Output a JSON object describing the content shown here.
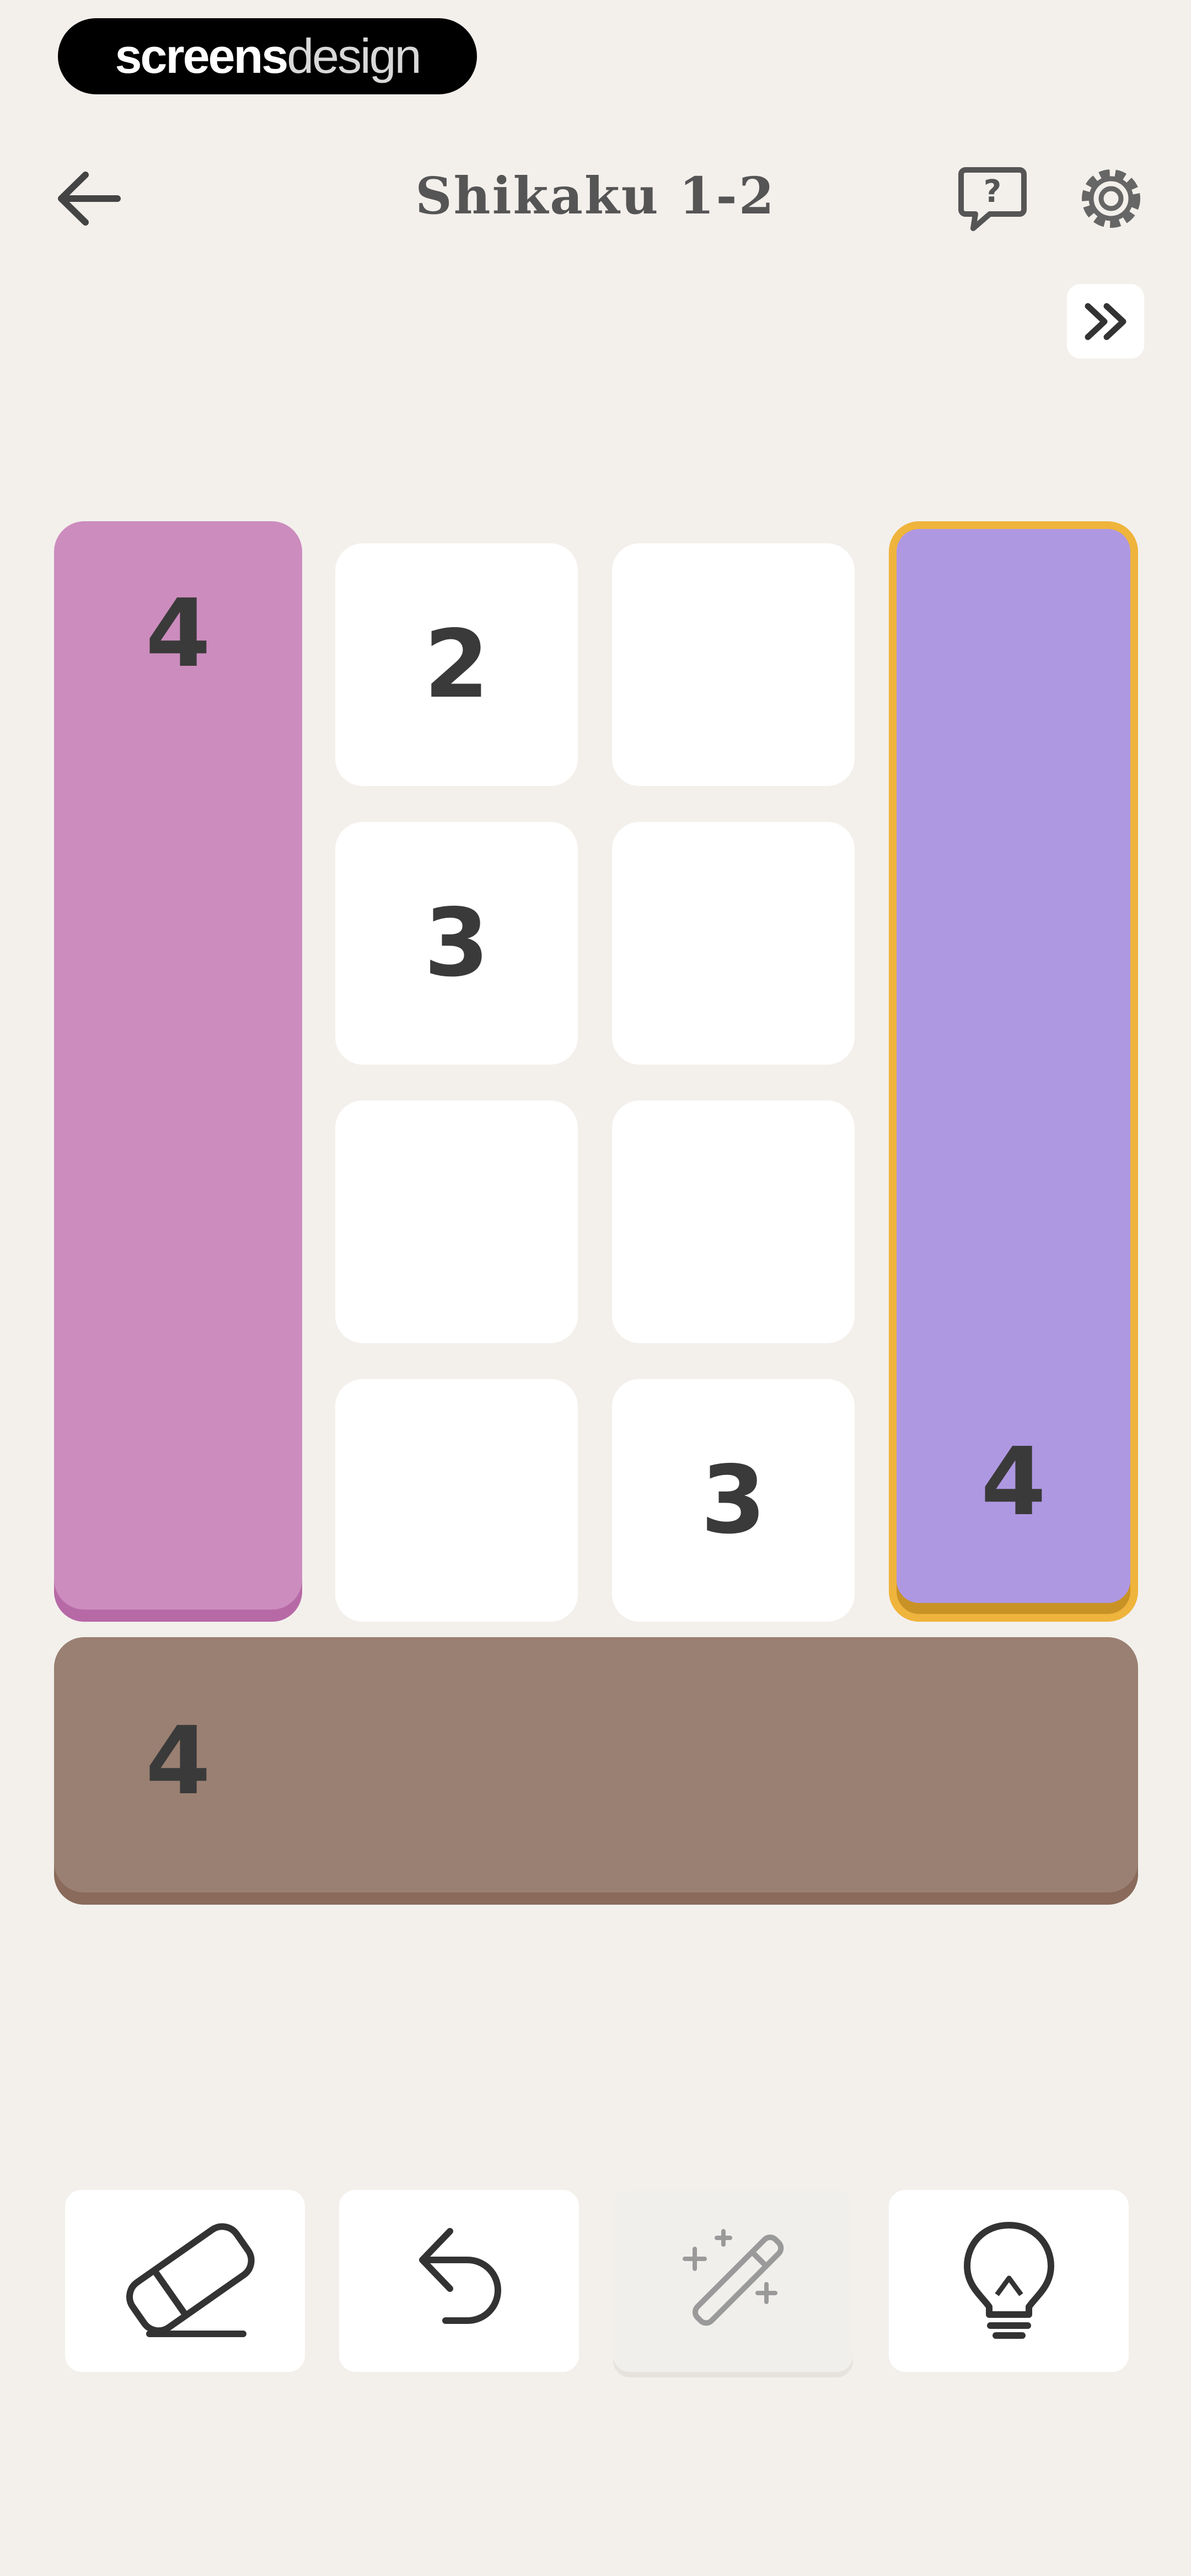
{
  "badge": {
    "part1": "screens",
    "part2": "design"
  },
  "header": {
    "title": "Shikaku 1-2"
  },
  "icons": {
    "back": "arrow-left-icon",
    "help": "question-bubble-icon",
    "settings": "gear-icon",
    "skip": "double-chevron-right-icon",
    "eraser": "eraser-icon",
    "undo": "undo-icon",
    "wand": "magic-wand-icon",
    "hint": "lightbulb-icon"
  },
  "colors": {
    "background": "#f3f0ec",
    "region_left": "#cc8cbe",
    "region_right": "#af98e2",
    "region_right_border": "#efb43c",
    "region_bottom": "#9a8072",
    "cell": "#ffffff"
  },
  "board": {
    "rows": 5,
    "cols": 4,
    "cells": [
      {
        "row": 0,
        "col": 1,
        "value": "2"
      },
      {
        "row": 0,
        "col": 2,
        "value": ""
      },
      {
        "row": 1,
        "col": 1,
        "value": "3"
      },
      {
        "row": 1,
        "col": 2,
        "value": ""
      },
      {
        "row": 2,
        "col": 1,
        "value": ""
      },
      {
        "row": 2,
        "col": 2,
        "value": ""
      },
      {
        "row": 3,
        "col": 1,
        "value": ""
      },
      {
        "row": 3,
        "col": 2,
        "value": "3"
      }
    ],
    "regions": {
      "left": {
        "value": "4"
      },
      "right": {
        "value": "4",
        "selected": true
      },
      "bottom": {
        "value": "4"
      }
    }
  },
  "toolbar": {
    "wand_disabled": true
  }
}
